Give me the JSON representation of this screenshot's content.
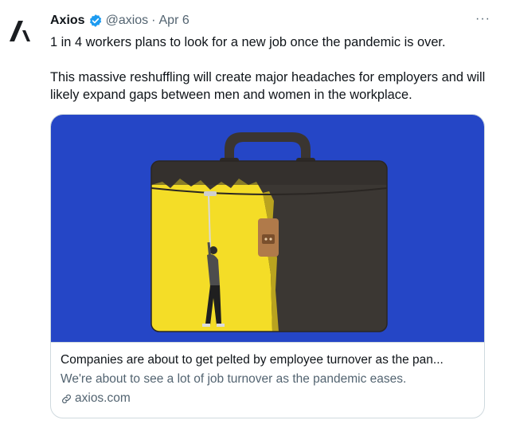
{
  "tweet": {
    "author_name": "Axios",
    "handle": "@axios",
    "separator": "·",
    "date": "Apr 6",
    "more_label": "···",
    "paragraphs": [
      "1 in 4 workers plans to look for a new job once the pandemic is over.",
      "This massive reshuffling will create major headaches for employers and will likely expand gaps between men and women in the workplace."
    ]
  },
  "card": {
    "title": "Companies are about to get pelted by employee turnover as the pan...",
    "description": "We're about to see a lot of job turnover as the pandemic eases.",
    "domain": "axios.com"
  },
  "colors": {
    "text_primary": "#0f1419",
    "text_secondary": "#536471",
    "verified": "#1d9bf0",
    "image_background": "#2546c6",
    "briefcase_dark": "#3b3733",
    "briefcase_yellow": "#f4dd27"
  },
  "icons": {
    "avatar": "axios-logo-icon",
    "verified": "verified-badge-icon",
    "more": "more-horizontal-icon",
    "link": "link-icon"
  }
}
